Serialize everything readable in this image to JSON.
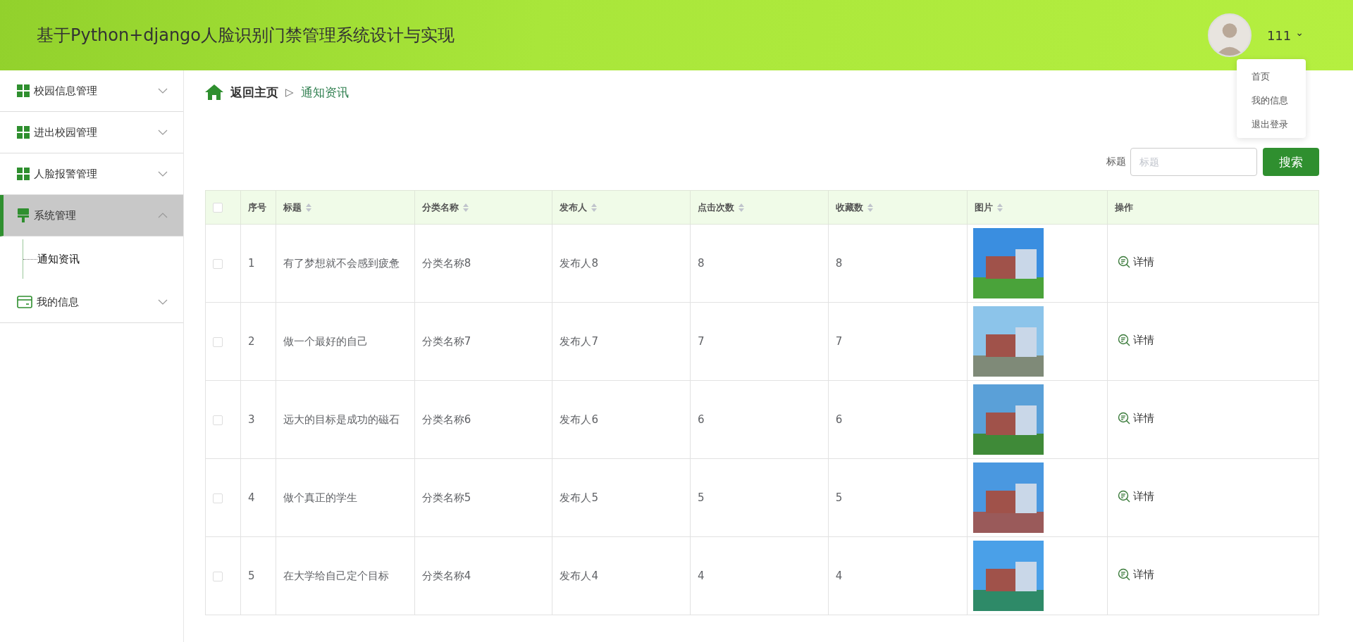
{
  "header": {
    "title": "基于Python+django人脸识别门禁管理系统设计与实现",
    "user": {
      "name": "111",
      "caret": "⌄"
    },
    "menu_open": true,
    "user_menu": [
      {
        "label": "首页"
      },
      {
        "label": "我的信息"
      },
      {
        "label": "退出登录"
      }
    ]
  },
  "sidebar": {
    "items": [
      {
        "label": "校园信息管理",
        "kind": "grid",
        "expanded": false,
        "selected": false
      },
      {
        "label": "进出校园管理",
        "kind": "grid",
        "expanded": false,
        "selected": false
      },
      {
        "label": "人脸报警管理",
        "kind": "grid",
        "expanded": false,
        "selected": false
      },
      {
        "label": "系统管理",
        "kind": "brush",
        "expanded": true,
        "selected": true,
        "children": [
          {
            "label": "通知资讯",
            "selected": true
          }
        ]
      },
      {
        "label": "我的信息",
        "kind": "card",
        "expanded": false,
        "selected": false
      }
    ]
  },
  "breadcrumb": {
    "home": "返回主页",
    "separator": "▷",
    "current": "通知资讯"
  },
  "search": {
    "label": "标题",
    "placeholder": "标题",
    "button": "搜索"
  },
  "table": {
    "all_checked": false,
    "columns": [
      {
        "label": "序号",
        "sortable": false
      },
      {
        "label": "标题",
        "sortable": true
      },
      {
        "label": "分类名称",
        "sortable": true
      },
      {
        "label": "发布人",
        "sortable": true
      },
      {
        "label": "点击次数",
        "sortable": true
      },
      {
        "label": "收藏数",
        "sortable": true
      },
      {
        "label": "图片",
        "sortable": true
      },
      {
        "label": "操作",
        "sortable": false
      }
    ],
    "rows": [
      {
        "checked": false,
        "cells": [
          "1",
          "有了梦想就不会感到疲惫",
          "分类名称8",
          "发布人8",
          "8",
          "8"
        ],
        "action": "详情"
      },
      {
        "checked": false,
        "cells": [
          "2",
          "做一个最好的自己",
          "分类名称7",
          "发布人7",
          "7",
          "7"
        ],
        "action": "详情"
      },
      {
        "checked": false,
        "cells": [
          "3",
          "远大的目标是成功的磁石",
          "分类名称6",
          "发布人6",
          "6",
          "6"
        ],
        "action": "详情"
      },
      {
        "checked": false,
        "cells": [
          "4",
          "做个真正的学生",
          "分类名称5",
          "发布人5",
          "5",
          "5"
        ],
        "action": "详情"
      },
      {
        "checked": false,
        "cells": [
          "5",
          "在大学给自己定个目标",
          "分类名称4",
          "发布人4",
          "4",
          "4"
        ],
        "action": "详情"
      }
    ]
  }
}
